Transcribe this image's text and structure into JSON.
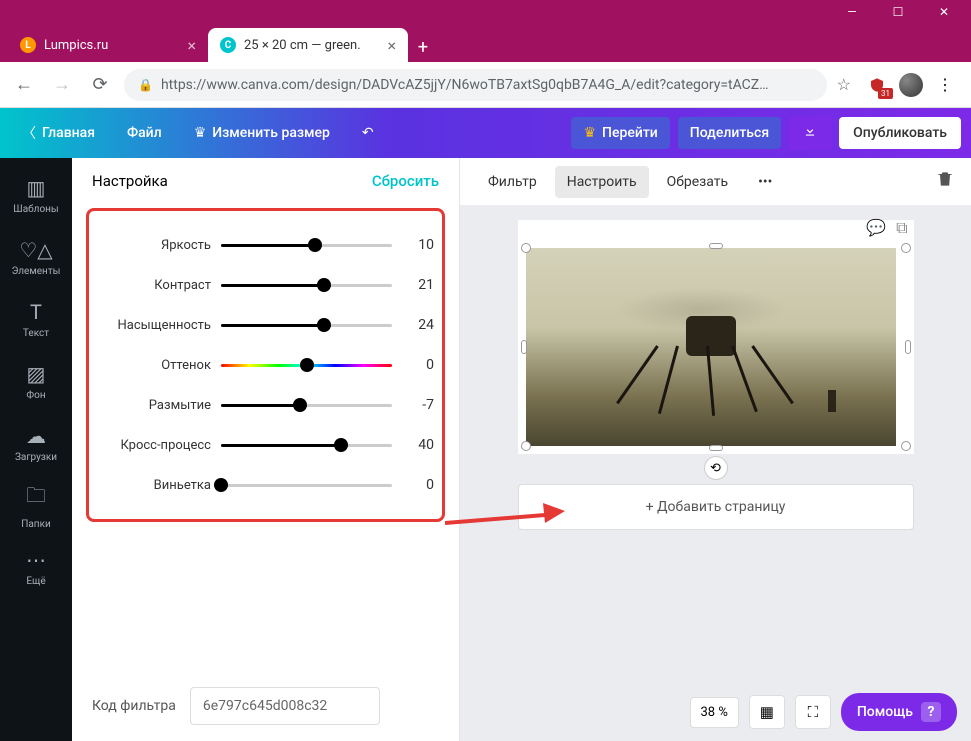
{
  "browser": {
    "tabs": [
      {
        "title": "Lumpics.ru",
        "favicon_color": "#ff9800"
      },
      {
        "title": "25 × 20 cm — green.",
        "favicon_color": "#00c4cc"
      }
    ],
    "url_display": "https://www.canva.com/design/DADVcAZ5jjY/N6woTB7axtSg0qbB7A4G_A/edit?category=tACZ…",
    "ext_badge": "31"
  },
  "header": {
    "home": "Главная",
    "file": "Файл",
    "resize": "Изменить размер",
    "upgrade": "Перейти",
    "share": "Поделиться",
    "publish": "Опубликовать"
  },
  "rail": {
    "templates": "Шаблоны",
    "elements": "Элементы",
    "text": "Текст",
    "background": "Фон",
    "uploads": "Загрузки",
    "folders": "Папки",
    "more": "Ещё"
  },
  "panel": {
    "title": "Настройка",
    "reset": "Сбросить",
    "sliders": [
      {
        "label": "Яркость",
        "value": 10,
        "pct": 55
      },
      {
        "label": "Контраст",
        "value": 21,
        "pct": 60
      },
      {
        "label": "Насыщенность",
        "value": 24,
        "pct": 60
      },
      {
        "label": "Оттенок",
        "value": 0,
        "pct": 50,
        "hue": true
      },
      {
        "label": "Размытие",
        "value": -7,
        "pct": 46
      },
      {
        "label": "Кросс-процесс",
        "value": 40,
        "pct": 70
      },
      {
        "label": "Виньетка",
        "value": 0,
        "pct": 0
      }
    ],
    "filter_code_label": "Код фильтра",
    "filter_code_value": "6e797c645d008c32"
  },
  "canvas": {
    "toolbar": {
      "filter": "Фильтр",
      "adjust": "Настроить",
      "crop": "Обрезать"
    },
    "add_page": "+ Добавить страницу",
    "zoom": "38 %",
    "help": "Помощь"
  }
}
